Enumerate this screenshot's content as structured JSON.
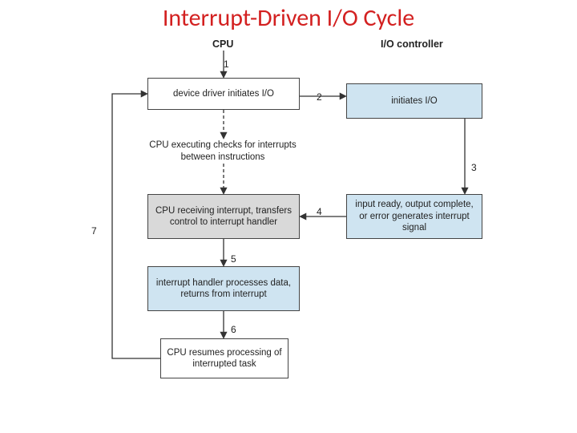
{
  "title": "Interrupt-Driven I/O Cycle",
  "columns": {
    "cpu": "CPU",
    "io": "I/O controller"
  },
  "steps": {
    "s1": "1",
    "s2": "2",
    "s3": "3",
    "s4": "4",
    "s5": "5",
    "s6": "6",
    "s7": "7"
  },
  "boxes": {
    "driver_initiates": "device driver initiates I/O",
    "initiates_io": "initiates I/O",
    "cpu_executing": "CPU executing checks for interrupts between instructions",
    "cpu_receiving": "CPU receiving interrupt, transfers control to interrupt handler",
    "input_ready": "input ready, output complete, or error generates interrupt signal",
    "handler_processes": "interrupt handler processes data, returns from interrupt",
    "cpu_resumes": "CPU resumes processing of interrupted task"
  }
}
